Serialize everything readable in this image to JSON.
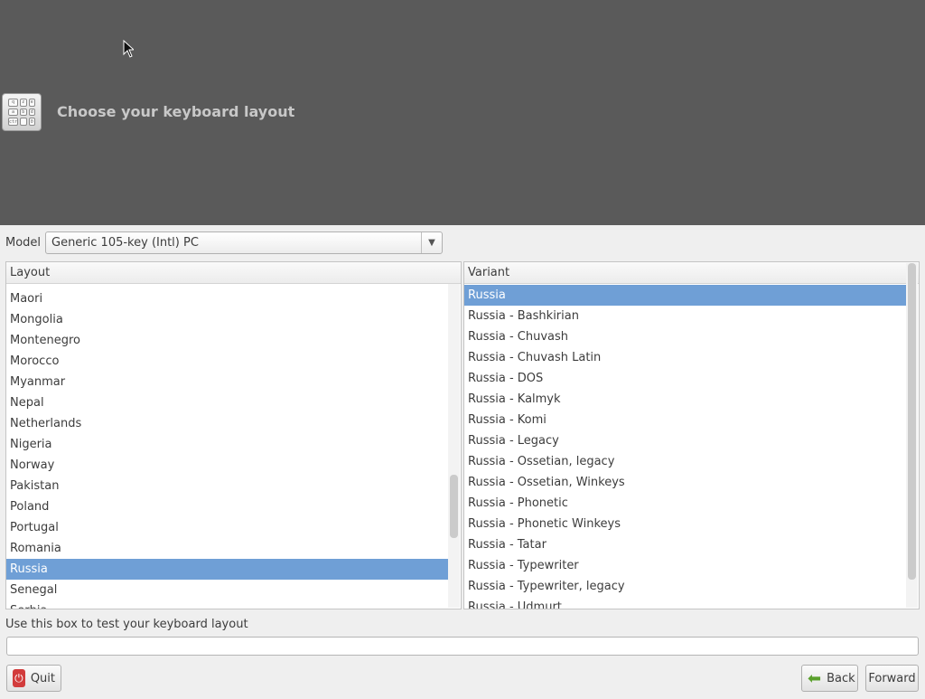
{
  "header": {
    "title": "Choose your keyboard layout",
    "icon": "keyboard-icon"
  },
  "model": {
    "label": "Model",
    "selected": "Generic 105-key (Intl) PC"
  },
  "layout_list": {
    "header": "Layout",
    "items": [
      "Maori",
      "Mongolia",
      "Montenegro",
      "Morocco",
      "Myanmar",
      "Nepal",
      "Netherlands",
      "Nigeria",
      "Norway",
      "Pakistan",
      "Poland",
      "Portugal",
      "Romania",
      "Russia",
      "Senegal",
      "Serbia"
    ],
    "selected": "Russia"
  },
  "variant_list": {
    "header": "Variant",
    "items": [
      "Russia",
      "Russia - Bashkirian",
      "Russia - Chuvash",
      "Russia - Chuvash Latin",
      "Russia - DOS",
      "Russia - Kalmyk",
      "Russia - Komi",
      "Russia - Legacy",
      "Russia - Ossetian, legacy",
      "Russia - Ossetian, Winkeys",
      "Russia - Phonetic",
      "Russia - Phonetic Winkeys",
      "Russia - Tatar",
      "Russia - Typewriter",
      "Russia - Typewriter, legacy",
      "Russia - Udmurt"
    ],
    "selected": "Russia"
  },
  "test": {
    "label": "Use this box to test your keyboard layout",
    "value": "",
    "placeholder": ""
  },
  "buttons": {
    "quit": "Quit",
    "back": "Back",
    "forward": "Forward"
  },
  "colors": {
    "header_bg": "#5a5a5a",
    "selection": "#6f9fd6"
  }
}
